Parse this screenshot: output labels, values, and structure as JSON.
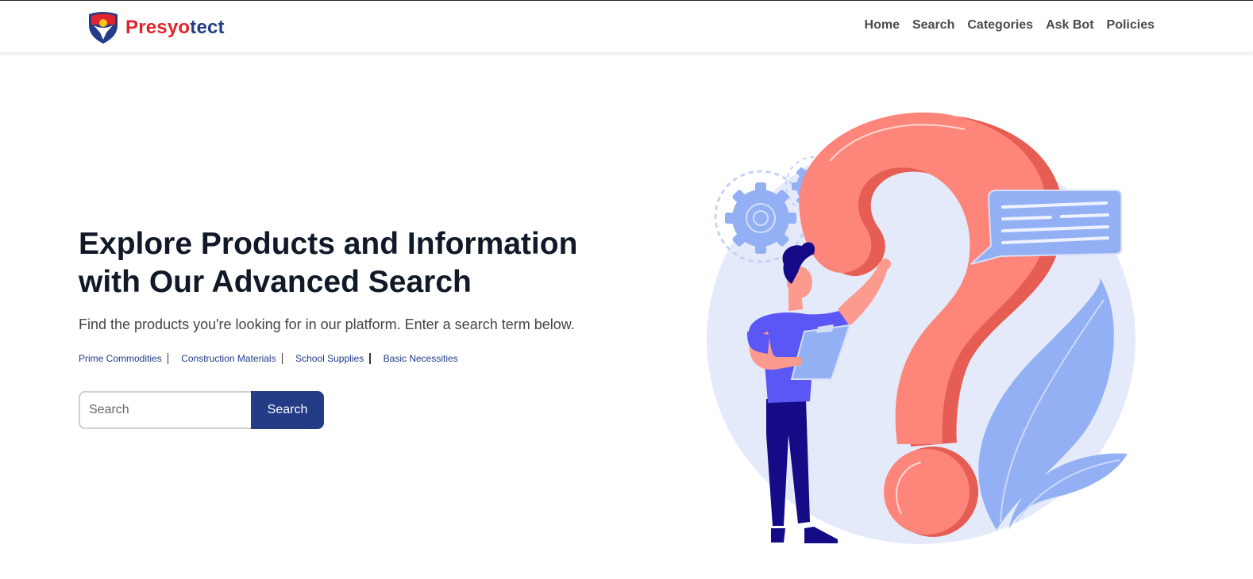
{
  "brand": {
    "name_part_a": "Presyo",
    "name_part_b": "tect",
    "logo_icon": "shield-logo-icon",
    "colors": {
      "red": "#e0232c",
      "navy": "#243c86"
    }
  },
  "nav": {
    "items": [
      {
        "label": "Home"
      },
      {
        "label": "Search"
      },
      {
        "label": "Categories"
      },
      {
        "label": "Ask Bot"
      },
      {
        "label": "Policies"
      }
    ]
  },
  "hero": {
    "title": "Explore Products and Information with Our Advanced Search",
    "subtitle": "Find the products you're looking for in our platform. Enter a search term below.",
    "categories": [
      {
        "label": "Prime Commodities"
      },
      {
        "label": "Construction Materials"
      },
      {
        "label": "School Supplies"
      },
      {
        "label": "Basic Necessities"
      }
    ]
  },
  "search": {
    "placeholder": "Search",
    "value": "",
    "button_label": "Search"
  },
  "illustration": {
    "icons": [
      "question-mark-icon",
      "gear-icon",
      "chat-bubble-icon",
      "leaf-icon",
      "person-with-clipboard"
    ],
    "colors": {
      "background_circle": "#e5eafb",
      "question_mark": "#fd8579",
      "question_mark_shade": "#e65d53",
      "accent_blue": "#93b0f5",
      "shirt": "#5a57f5",
      "pants": "#150b86"
    }
  }
}
